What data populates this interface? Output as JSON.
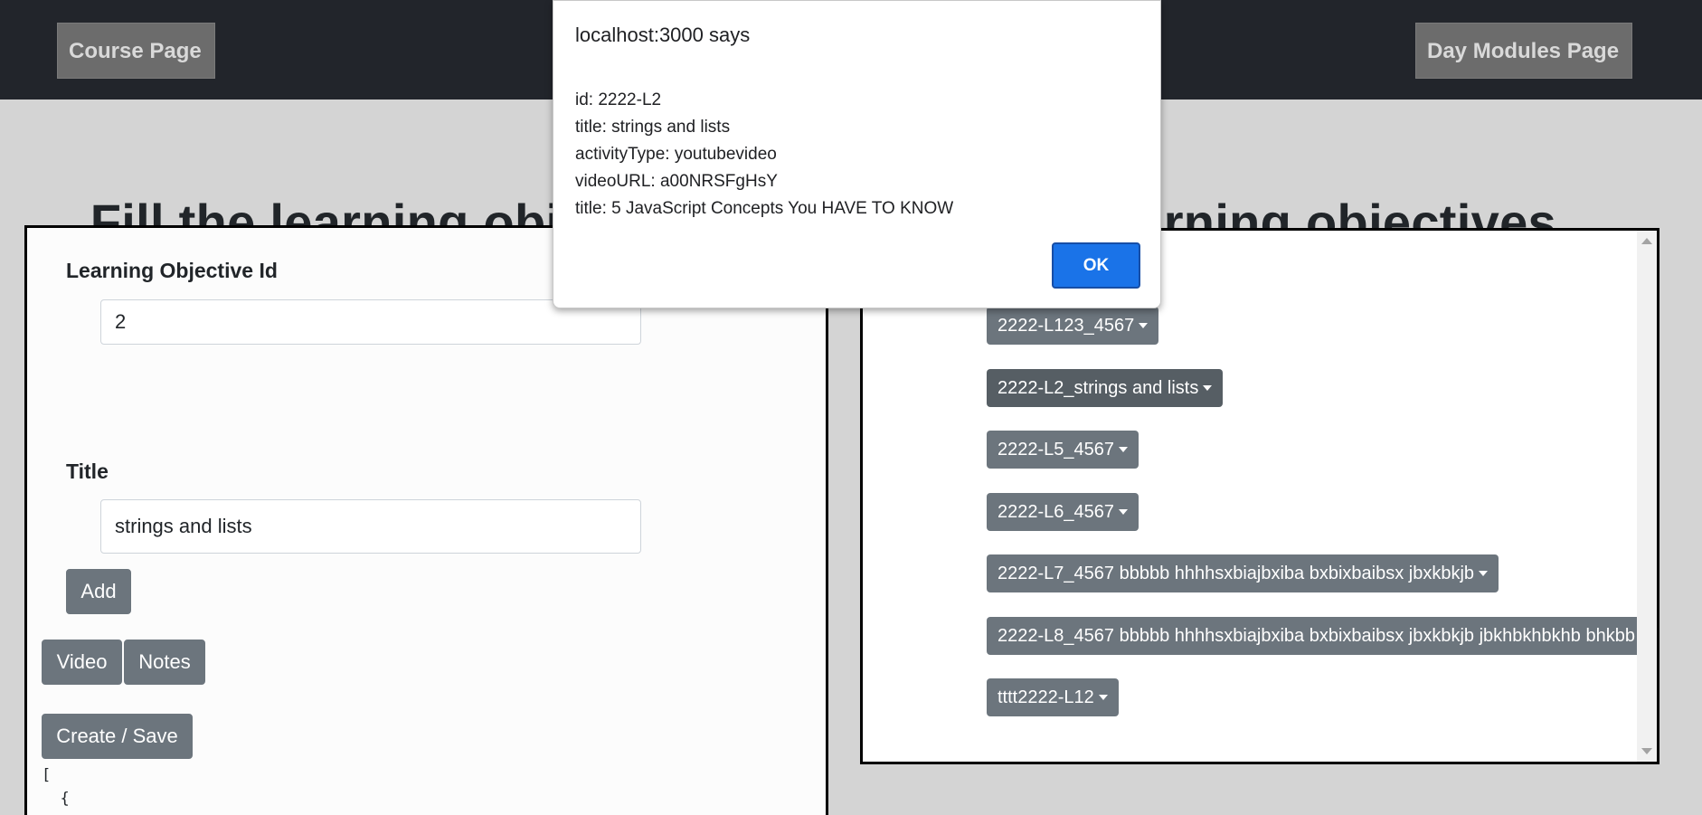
{
  "navbar": {
    "course_page_label": "Course Page",
    "day_modules_page_label": "Day Modules Page"
  },
  "heading": {
    "left_text": "Fill the learning objec",
    "right_text": "rning objectives"
  },
  "form": {
    "objective_id_label": "Learning Objective Id",
    "objective_id_value": "2",
    "title_label": "Title",
    "title_value": "strings and lists",
    "add_label": "Add",
    "video_label": "Video",
    "notes_label": "Notes",
    "create_save_label": "Create / Save",
    "json_lines": [
      "[",
      "  {"
    ]
  },
  "objectives_list": {
    "items": [
      {
        "label": "2222-L123_4567",
        "active": false
      },
      {
        "label": "2222-L2_strings and lists",
        "active": true
      },
      {
        "label": "2222-L5_4567",
        "active": false
      },
      {
        "label": "2222-L6_4567",
        "active": false
      },
      {
        "label": "2222-L7_4567 bbbbb hhhhsxbiajbxiba bxbixbaibsx jbxkbkjb",
        "active": false
      },
      {
        "label": "2222-L8_4567 bbbbb hhhhsxbiajbxiba bxbixbaibsx jbxkbkjb jbkhbkhbkhb bhkbb",
        "active": false
      },
      {
        "label": "tttt2222-L12",
        "active": false
      }
    ]
  },
  "alert_dialog": {
    "title": "localhost:3000 says",
    "lines": [
      "id: 2222-L2",
      "title: strings and lists",
      "activityType: youtubevideo",
      "videoURL: a00NRSFgHsY",
      "title: 5 JavaScript Concepts You HAVE TO KNOW"
    ],
    "ok_label": "OK"
  },
  "colors": {
    "navbar_bg": "#22252b",
    "page_bg": "#d4d4d4",
    "secondary_button": "#6c757d",
    "ok_button": "#1a73e8"
  }
}
